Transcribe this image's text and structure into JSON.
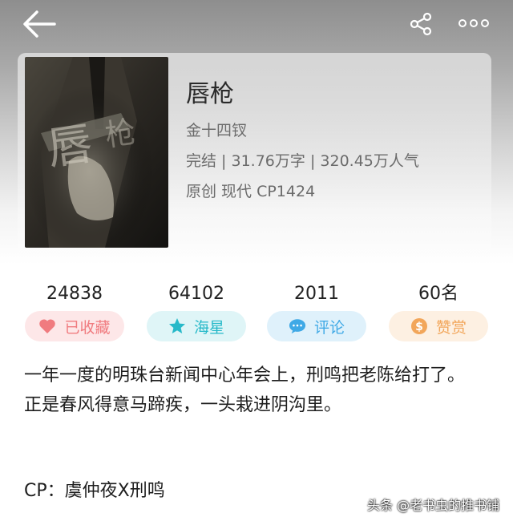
{
  "topbar": {
    "back_icon": "arrow-left-icon",
    "share_icon": "share-icon",
    "more_icon": "more-dots-icon"
  },
  "book": {
    "title": "唇枪",
    "author": "金十四钗",
    "status": "完结",
    "word_count": "31.76万字",
    "popularity": "320.45万人气",
    "meta_sep": " | ",
    "tags": "原创  现代  CP1424"
  },
  "stats": [
    {
      "value": "24838",
      "label": "已收藏",
      "icon": "heart-icon",
      "bg": "#fde7e8",
      "fg": "#f07b7f"
    },
    {
      "value": "64102",
      "label": "海星",
      "icon": "star-icon",
      "bg": "#dff5f7",
      "fg": "#27b9c9"
    },
    {
      "value": "2011",
      "label": "评论",
      "icon": "comment-icon",
      "bg": "#dff1fb",
      "fg": "#3fa9e6"
    },
    {
      "value": "60名",
      "label": "赞赏",
      "icon": "coin-icon",
      "bg": "#fdf0e2",
      "fg": "#f2a65a"
    }
  ],
  "description": {
    "line1": "一年一度的明珠台新闻中心年会上，刑鸣把老陈给打了。",
    "line2": "正是春风得意马蹄疾，一头栽进阴沟里。"
  },
  "cp": "CP：虞仲夜X刑鸣",
  "watermark": "头条 @老书虫的推书铺"
}
